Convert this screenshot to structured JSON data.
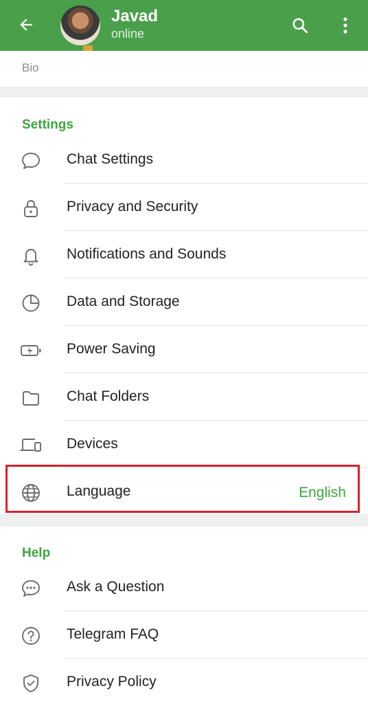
{
  "header": {
    "name": "Javad",
    "status": "online",
    "icons": [
      "back-arrow-icon",
      "search-icon",
      "more-vertical-icon"
    ],
    "background_color": "#4aa04a"
  },
  "bio": {
    "label": "Bio"
  },
  "settings": {
    "title": "Settings",
    "items": [
      {
        "label": "Chat Settings",
        "icon": "chat-bubble-icon"
      },
      {
        "label": "Privacy and Security",
        "icon": "lock-icon"
      },
      {
        "label": "Notifications and Sounds",
        "icon": "bell-icon"
      },
      {
        "label": "Data and Storage",
        "icon": "pie-chart-icon"
      },
      {
        "label": "Power Saving",
        "icon": "battery-icon"
      },
      {
        "label": "Chat Folders",
        "icon": "folder-icon"
      },
      {
        "label": "Devices",
        "icon": "devices-icon"
      },
      {
        "label": "Language",
        "value": "English",
        "icon": "globe-icon",
        "highlighted": true
      }
    ]
  },
  "help": {
    "title": "Help",
    "items": [
      {
        "label": "Ask a Question",
        "icon": "chat-dots-icon"
      },
      {
        "label": "Telegram FAQ",
        "icon": "question-circle-icon"
      },
      {
        "label": "Privacy Policy",
        "icon": "shield-check-icon"
      }
    ]
  },
  "colors": {
    "accent": "#3fa33f",
    "highlight_border": "#d0242e"
  }
}
